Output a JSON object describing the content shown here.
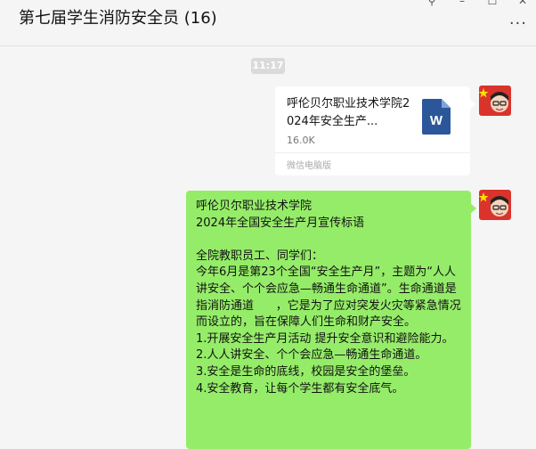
{
  "window": {
    "title": "第七届学生消防安全员 (16)",
    "controls": {
      "pin": "⚲",
      "minimize": "–",
      "maximize": "☐",
      "close": "✕"
    },
    "more": "···"
  },
  "chat": {
    "timestamp": "11:17",
    "file_message": {
      "name": "呼伦贝尔职业技术学院2024年安全生产...",
      "size": "16.0K",
      "source": "微信电脑版",
      "icon_letter": "W",
      "icon": "word-document-icon"
    },
    "text_message": {
      "lines": [
        "呼伦贝尔职业技术学院",
        "2024年全国安全生产月宣传标语",
        "",
        "全院教职员工、同学们：",
        "今年6月是第23个全国“安全生产月”，主题为“人人讲安全、个个会应急—畅通生命通道”。生命通道是指消防通道      ，它是为了应对突发火灾等紧急情况而设立的，旨在保障人们生命和财产安全。",
        "1.开展安全生产月活动 提升安全意识和避险能力。",
        "2.人人讲安全、个个会应急—畅通生命通道。",
        "3.安全是生命的底线，校园是安全的堡垒。",
        "4.安全教育，让每个学生都有安全底气。"
      ]
    }
  },
  "colors": {
    "sent_bubble": "#95ec69",
    "file_bubble": "#ffffff",
    "word_blue": "#2b579a",
    "background": "#f5f5f5"
  }
}
